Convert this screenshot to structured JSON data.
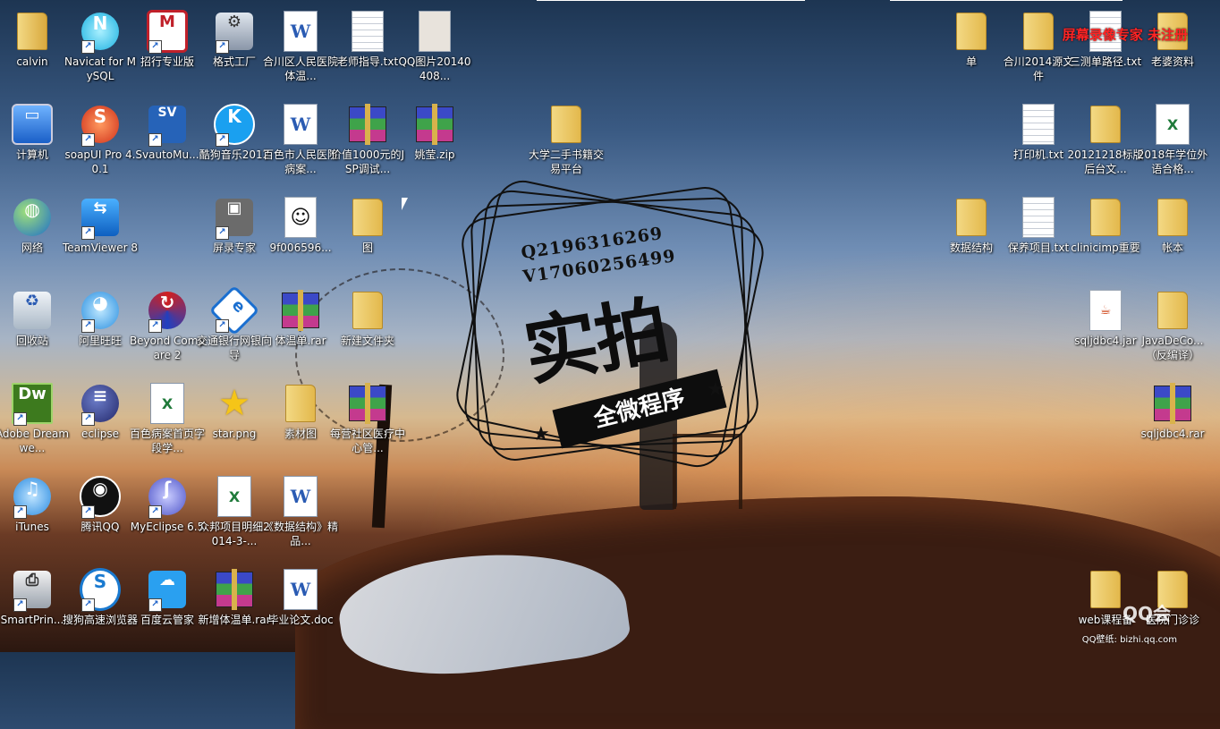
{
  "desktop": {
    "watermark": "屏幕录像专家  未注册",
    "overlay": {
      "contact_q": "Q2196316269",
      "contact_v": "V17060256499",
      "big": "实拍",
      "ribbon": "全微程序"
    },
    "wallpaper_credit": {
      "logo": "QQ会",
      "site": "QQ壁纸: bizhi.qq.com"
    },
    "icons": [
      {
        "id": "calvin",
        "label": "calvin",
        "icon": "user-folder-icon",
        "shortcut": false
      },
      {
        "id": "navicat",
        "label": "Navicat for MySQL",
        "icon": "navicat-icon",
        "shortcut": true
      },
      {
        "id": "cmb",
        "label": "招行专业版",
        "icon": "cmb-bank-icon",
        "shortcut": true
      },
      {
        "id": "format-factory",
        "label": "格式工厂",
        "icon": "format-factory-icon",
        "shortcut": true
      },
      {
        "id": "hechuan-doc",
        "label": "合川区人民医院体温...",
        "icon": "word-doc-icon",
        "shortcut": false
      },
      {
        "id": "teacher-txt",
        "label": "老师指导.txt",
        "icon": "text-file-icon",
        "shortcut": false
      },
      {
        "id": "qq-image",
        "label": "QQ图片20140408...",
        "icon": "image-file-icon",
        "shortcut": false
      },
      {
        "id": "computer",
        "label": "计算机",
        "icon": "computer-icon",
        "shortcut": false
      },
      {
        "id": "soapui",
        "label": "soapUI Pro 4.0.1",
        "icon": "soapui-icon",
        "shortcut": true
      },
      {
        "id": "svauto",
        "label": "SvautoMu...",
        "icon": "svauto-icon",
        "shortcut": true
      },
      {
        "id": "kugou",
        "label": "酷狗音乐2012",
        "icon": "kugou-icon",
        "shortcut": true
      },
      {
        "id": "baise-doc",
        "label": "百色市人民医院病案...",
        "icon": "word-doc-icon",
        "shortcut": false
      },
      {
        "id": "jsp-rar",
        "label": "价值1000元的JSP调试...",
        "icon": "rar-archive-icon",
        "shortcut": false
      },
      {
        "id": "yaoying-zip",
        "label": "姚莹.zip",
        "icon": "rar-archive-icon",
        "shortcut": false
      },
      {
        "id": "secondhand",
        "label": "大学二手书籍交易平台",
        "icon": "folder-icon",
        "shortcut": false
      },
      {
        "id": "network",
        "label": "网络",
        "icon": "network-globe-icon",
        "shortcut": false
      },
      {
        "id": "teamviewer",
        "label": "TeamViewer 8",
        "icon": "teamviewer-icon",
        "shortcut": true
      },
      {
        "id": "screen-recorder",
        "label": "屏录专家",
        "icon": "camera-icon",
        "shortcut": true
      },
      {
        "id": "9f006",
        "label": "9f006596...",
        "icon": "avatar-image-icon",
        "shortcut": false
      },
      {
        "id": "tu",
        "label": "图",
        "icon": "folder-icon",
        "shortcut": false
      },
      {
        "id": "recycle",
        "label": "回收站",
        "icon": "recycle-bin-icon",
        "shortcut": false
      },
      {
        "id": "aliwangwang",
        "label": "阿里旺旺",
        "icon": "aliwangwang-icon",
        "shortcut": true
      },
      {
        "id": "beyond",
        "label": "Beyond Compare 2",
        "icon": "beyond-compare-icon",
        "shortcut": true
      },
      {
        "id": "bocom",
        "label": "交通银行网银向导",
        "icon": "bocom-bank-icon",
        "shortcut": true
      },
      {
        "id": "tiwen-rar",
        "label": "体温单.rar",
        "icon": "rar-archive-icon",
        "shortcut": false
      },
      {
        "id": "new-folder",
        "label": "新建文件夹",
        "icon": "folder-icon",
        "shortcut": false
      },
      {
        "id": "dreamweaver",
        "label": "Adobe Dreamwe...",
        "icon": "dreamweaver-icon",
        "shortcut": true
      },
      {
        "id": "eclipse",
        "label": "eclipse",
        "icon": "eclipse-icon",
        "shortcut": true
      },
      {
        "id": "baise-xls",
        "label": "百色病案首页字段学...",
        "icon": "excel-doc-icon",
        "shortcut": false
      },
      {
        "id": "star-png",
        "label": "star.png",
        "icon": "star-icon",
        "shortcut": false
      },
      {
        "id": "sucai",
        "label": "素材图",
        "icon": "folder-icon",
        "shortcut": false
      },
      {
        "id": "community-rar",
        "label": "每营社区医疗中心管...",
        "icon": "rar-archive-icon",
        "shortcut": false
      },
      {
        "id": "itunes",
        "label": "iTunes",
        "icon": "itunes-icon",
        "shortcut": true
      },
      {
        "id": "qq",
        "label": "腾讯QQ",
        "icon": "qq-penguin-icon",
        "shortcut": true
      },
      {
        "id": "myeclipse",
        "label": "MyEclipse 6.5",
        "icon": "myeclipse-icon",
        "shortcut": true
      },
      {
        "id": "zhongbang-xls",
        "label": "众邦项目明细2014-3-...",
        "icon": "excel-doc-icon",
        "shortcut": false
      },
      {
        "id": "datastruct-doc",
        "label": "《数据结构》精品...",
        "icon": "word-doc-icon",
        "shortcut": false
      },
      {
        "id": "smartprinter",
        "label": "SmartPrin...",
        "icon": "printer-icon",
        "shortcut": true
      },
      {
        "id": "sogou",
        "label": "搜狗高速浏览器",
        "icon": "sogou-browser-icon",
        "shortcut": true
      },
      {
        "id": "baiduyun",
        "label": "百度云管家",
        "icon": "baidu-cloud-icon",
        "shortcut": true
      },
      {
        "id": "new-tiwen-rar",
        "label": "新增体温单.rar",
        "icon": "rar-archive-icon",
        "shortcut": false
      },
      {
        "id": "thesis-doc",
        "label": "毕业论文.doc",
        "icon": "word-doc-icon",
        "shortcut": false
      },
      {
        "id": "dan",
        "label": "单",
        "icon": "folder-icon",
        "shortcut": false
      },
      {
        "id": "hechuan2014",
        "label": "合川2014源文件",
        "icon": "folder-icon",
        "shortcut": false
      },
      {
        "id": "sance-txt",
        "label": "三测单路径.txt",
        "icon": "text-file-icon",
        "shortcut": false
      },
      {
        "id": "laopo",
        "label": "老婆资料",
        "icon": "folder-icon",
        "shortcut": false
      },
      {
        "id": "printer-txt",
        "label": "打印机.txt",
        "icon": "text-file-icon",
        "shortcut": false
      },
      {
        "id": "20121218",
        "label": "20121218标版后台文...",
        "icon": "folder-icon",
        "shortcut": false
      },
      {
        "id": "2018-xls",
        "label": "2018年学位外语合格...",
        "icon": "excel-doc-icon",
        "shortcut": false
      },
      {
        "id": "datastruct-folder",
        "label": "数据结构",
        "icon": "folder-icon",
        "shortcut": false
      },
      {
        "id": "baoyang-txt",
        "label": "保养项目.txt",
        "icon": "text-file-icon",
        "shortcut": false
      },
      {
        "id": "clinicimp",
        "label": "clinicimp重要",
        "icon": "folder-icon",
        "shortcut": false
      },
      {
        "id": "zhangben",
        "label": "帐本",
        "icon": "folder-icon",
        "shortcut": false
      },
      {
        "id": "sqljdbc-jar",
        "label": "sqljdbc4.jar",
        "icon": "java-jar-icon",
        "shortcut": false
      },
      {
        "id": "javadeco",
        "label": "JavaDeCo...（反编译）",
        "icon": "folder-icon",
        "shortcut": false
      },
      {
        "id": "sqljdbc-rar",
        "label": "sqljdbc4.rar",
        "icon": "rar-archive-icon",
        "shortcut": false
      },
      {
        "id": "web-course",
        "label": "web课程备",
        "icon": "folder-icon",
        "shortcut": false
      },
      {
        "id": "clinic",
        "label": "医院门诊诊",
        "icon": "folder-icon",
        "shortcut": false
      }
    ]
  }
}
